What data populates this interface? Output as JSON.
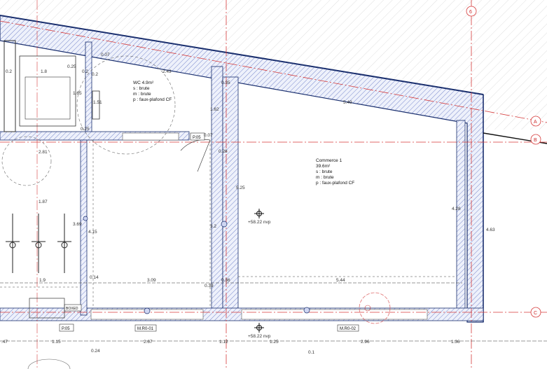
{
  "grid_labels": [
    "6",
    "A",
    "B",
    "C"
  ],
  "rooms": {
    "wc": {
      "title": "WC 4.9m²",
      "lines": [
        "s : brute",
        "m : brute",
        "p : faux-plafond CF"
      ]
    },
    "commerce": {
      "title": "Commerce 1",
      "area": "39.6m²",
      "lines": [
        "s : brute",
        "m : brute",
        "p : faux-plafond CF"
      ]
    }
  },
  "levels": [
    "+58.22 nvp",
    "+58.22 nvp"
  ],
  "tags": {
    "p05_upper": "P.05",
    "p05_lower": "P.05",
    "boxed": "BOXED",
    "mr01": "M.R0-01",
    "mr02": "M.R0-02"
  },
  "dimensions": {
    "wc_top_a": "0.2",
    "wc_top_b": "1.8",
    "wc_top_c": "0.2",
    "wc_width": "2.43",
    "wc_side_a": "0.2",
    "wc_vert": "1.65",
    "wc_vert2": "1.51",
    "wc_vert3": "0.25",
    "wc_small": "0.07",
    "wc_small2": "0.35",
    "wc_small3": "0.25",
    "wc_vert4": "1.62",
    "door_small": "0.07",
    "door_small2": "0.28",
    "left_width": "2.81",
    "bike_width": "1.87",
    "bike_vert": "3.69",
    "bike_vert2": "4.15",
    "com_top": "5.49",
    "com_vert_left": "5.25",
    "com_vert_right": "4.28",
    "com_outer_vert": "4.63",
    "mid_vert": "3.2",
    "row_19": "1.9",
    "row_014": "0.14",
    "row_309": "3.09",
    "row_039": "0.39",
    "row_036": "0.36",
    "row_544": "5.44",
    "bot_047": ".47",
    "bot_115": "1.15",
    "bot_267": "2.67",
    "bot_112": "1.12",
    "bot_125": "1.25",
    "bot_296": "2.96",
    "bot_136": "1.36",
    "bot_024": "0.24",
    "bot_01": "0.1"
  }
}
